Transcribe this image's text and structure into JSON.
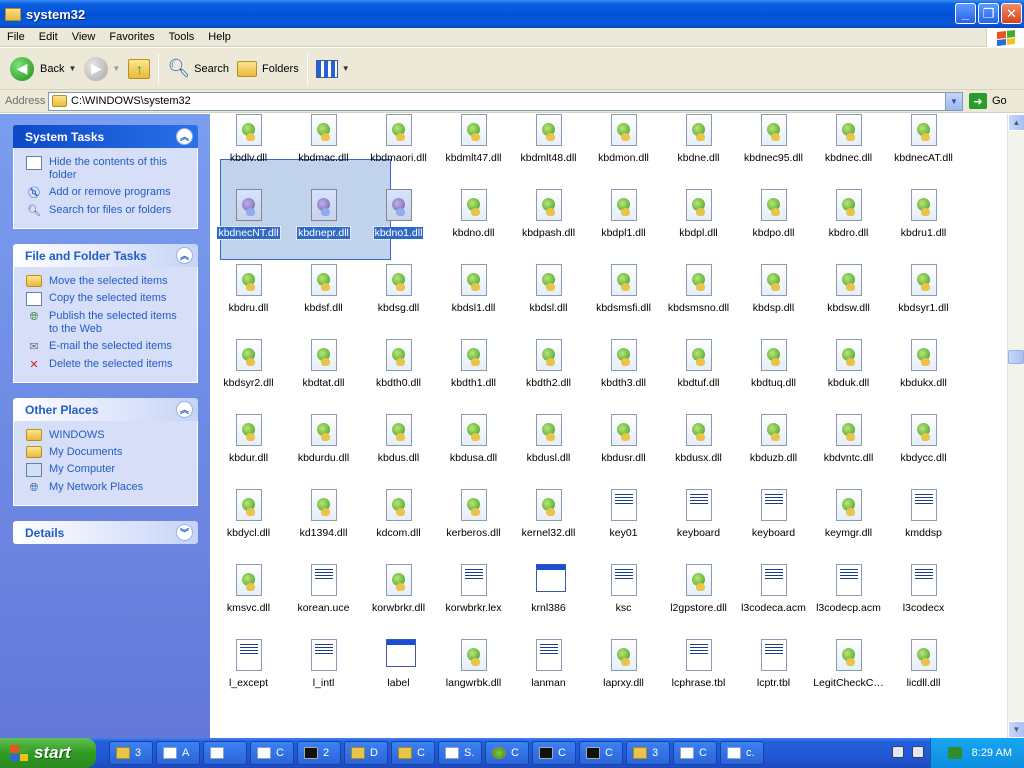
{
  "window": {
    "title": "system32"
  },
  "menu": [
    "File",
    "Edit",
    "View",
    "Favorites",
    "Tools",
    "Help"
  ],
  "toolbar": {
    "back": "Back",
    "search": "Search",
    "folders": "Folders"
  },
  "address": {
    "label": "Address",
    "value": "C:\\WINDOWS\\system32",
    "go": "Go"
  },
  "sidebar": {
    "system_tasks": {
      "title": "System Tasks",
      "items": [
        "Hide the contents of this folder",
        "Add or remove programs",
        "Search for files or folders"
      ]
    },
    "file_tasks": {
      "title": "File and Folder Tasks",
      "items": [
        "Move the selected items",
        "Copy the selected items",
        "Publish the selected items to the Web",
        "E-mail the selected items",
        "Delete the selected items"
      ]
    },
    "other_places": {
      "title": "Other Places",
      "items": [
        "WINDOWS",
        "My Documents",
        "My Computer",
        "My Network Places"
      ]
    },
    "details": {
      "title": "Details"
    }
  },
  "files": [
    [
      "kbdlv.dll",
      "kbdmac.dll",
      "kbdmaori.dll",
      "kbdmlt47.dll",
      "kbdmlt48.dll",
      "kbdmon.dll",
      "kbdne.dll",
      "kbdnec95.dll",
      "kbdnec.dll",
      "kbdnecAT.dll"
    ],
    [
      "kbdnecNT.dll",
      "kbdnepr.dll",
      "kbdno1.dll",
      "kbdno.dll",
      "kbdpash.dll",
      "kbdpl1.dll",
      "kbdpl.dll",
      "kbdpo.dll",
      "kbdro.dll",
      "kbdru1.dll"
    ],
    [
      "kbdru.dll",
      "kbdsf.dll",
      "kbdsg.dll",
      "kbdsl1.dll",
      "kbdsl.dll",
      "kbdsmsfi.dll",
      "kbdsmsno.dll",
      "kbdsp.dll",
      "kbdsw.dll",
      "kbdsyr1.dll"
    ],
    [
      "kbdsyr2.dll",
      "kbdtat.dll",
      "kbdth0.dll",
      "kbdth1.dll",
      "kbdth2.dll",
      "kbdth3.dll",
      "kbdtuf.dll",
      "kbdtuq.dll",
      "kbduk.dll",
      "kbdukx.dll"
    ],
    [
      "kbdur.dll",
      "kbdurdu.dll",
      "kbdus.dll",
      "kbdusa.dll",
      "kbdusl.dll",
      "kbdusr.dll",
      "kbdusx.dll",
      "kbduzb.dll",
      "kbdvntc.dll",
      "kbdycc.dll"
    ],
    [
      "kbdycl.dll",
      "kd1394.dll",
      "kdcom.dll",
      "kerberos.dll",
      "kernel32.dll",
      "key01",
      "keyboard",
      "keyboard",
      "keymgr.dll",
      "kmddsp"
    ],
    [
      "kmsvc.dll",
      "korean.uce",
      "korwbrkr.dll",
      "korwbrkr.lex",
      "krnl386",
      "ksc",
      "l2gpstore.dll",
      "l3codeca.acm",
      "l3codecp.acm",
      "l3codecx"
    ],
    [
      "l_except",
      "l_intl",
      "label",
      "langwrbk.dll",
      "lanman",
      "laprxy.dll",
      "lcphrase.tbl",
      "lcptr.tbl",
      "LegitCheckC…",
      "licdll.dll"
    ]
  ],
  "selected": [
    "kbdnecNT.dll",
    "kbdnepr.dll",
    "kbdno1.dll"
  ],
  "taskbar": {
    "start": "start",
    "tasks": [
      "3",
      "A",
      "",
      "C",
      "2",
      "D",
      "C",
      "S.",
      "C",
      "C",
      "C",
      "3",
      "C",
      "c."
    ],
    "clock": "8:29 AM"
  }
}
